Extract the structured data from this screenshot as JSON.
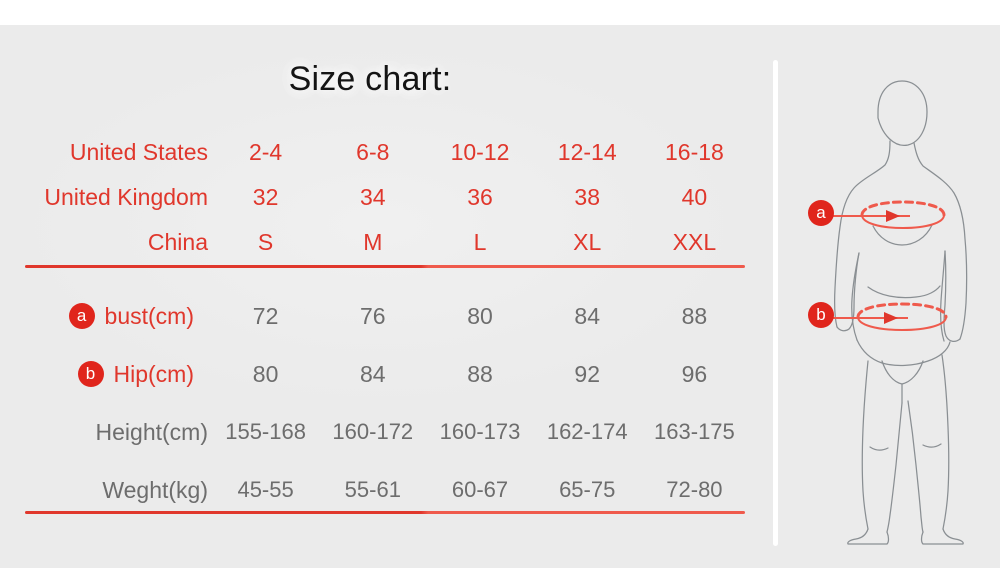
{
  "page": {
    "title": "Size chart:",
    "background_color": "#ebebeb",
    "accent_red": "#e0372c",
    "badge_red": "#e0251c",
    "value_grey": "#6d6d6d",
    "figure_outline": "#8a8f93"
  },
  "table": {
    "rows": [
      {
        "id": "united-states",
        "label": "United States",
        "label_style": "red",
        "badge": null,
        "values": [
          "2-4",
          "6-8",
          "10-12",
          "12-14",
          "16-18"
        ],
        "value_style": "red"
      },
      {
        "id": "united-kingdom",
        "label": "United Kingdom",
        "label_style": "red",
        "badge": null,
        "values": [
          "32",
          "34",
          "36",
          "38",
          "40"
        ],
        "value_style": "red"
      },
      {
        "id": "china",
        "label": "China",
        "label_style": "red",
        "badge": null,
        "values": [
          "S",
          "M",
          "L",
          "XL",
          "XXL"
        ],
        "value_style": "red"
      },
      {
        "id": "bust",
        "label": "bust(cm)",
        "label_style": "red",
        "badge": "a",
        "values": [
          "72",
          "76",
          "80",
          "84",
          "88"
        ],
        "value_style": "grey"
      },
      {
        "id": "hip",
        "label": "Hip(cm)",
        "label_style": "red",
        "badge": "b",
        "values": [
          "80",
          "84",
          "88",
          "92",
          "96"
        ],
        "value_style": "grey"
      },
      {
        "id": "height",
        "label": "Height(cm)",
        "label_style": "grey",
        "badge": null,
        "values": [
          "155-168",
          "160-172",
          "160-173",
          "162-174",
          "163-175"
        ],
        "value_style": "grey"
      },
      {
        "id": "weight",
        "label": "Weght(kg)",
        "label_style": "grey",
        "badge": null,
        "values": [
          "45-55",
          "55-61",
          "60-67",
          "65-75",
          "72-80"
        ],
        "value_style": "grey"
      }
    ]
  },
  "figure": {
    "bust_marker": "a",
    "hip_marker": "b"
  }
}
